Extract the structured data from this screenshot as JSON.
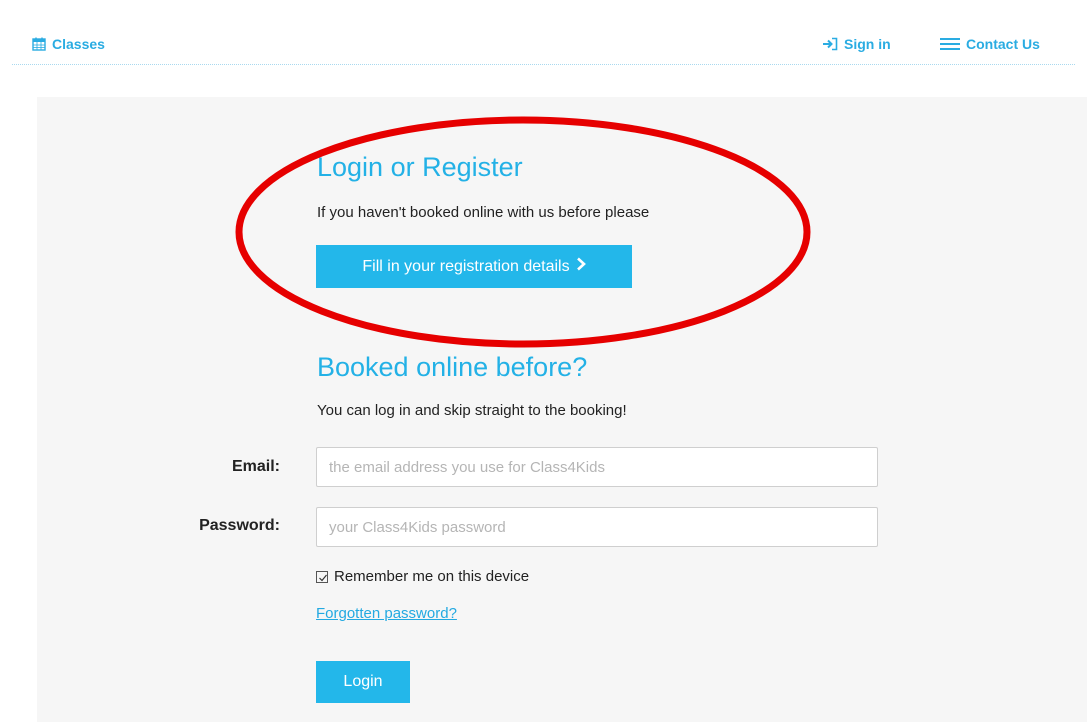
{
  "nav": {
    "classes_label": "Classes",
    "signin_label": "Sign in",
    "contact_label": "Contact Us"
  },
  "register": {
    "title": "Login or Register",
    "text": "If you haven't booked online with us before please",
    "button_label": "Fill in your registration details"
  },
  "login": {
    "title": "Booked online before?",
    "text": "You can log in and skip straight to the booking!",
    "email_label": "Email:",
    "email_placeholder": "the email address you use for Class4Kids",
    "email_value": "",
    "password_label": "Password:",
    "password_placeholder": "your Class4Kids password",
    "password_value": "",
    "remember_label": "Remember me on this device",
    "remember_checked": true,
    "forgot_label": "Forgotten password?",
    "login_button_label": "Login"
  },
  "colors": {
    "accent": "#23b7ea",
    "panel_bg": "#f6f6f6",
    "annotation_red": "#e60000"
  },
  "icons": {
    "classes": "calendar-icon",
    "signin": "sign-in-icon",
    "contact": "hamburger-menu-icon",
    "register_button": "chevron-right-icon",
    "remember": "checkbox-checked-icon"
  }
}
